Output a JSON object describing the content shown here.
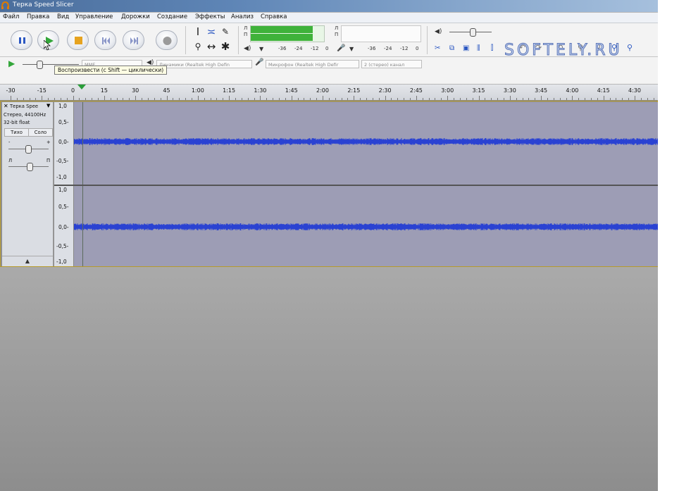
{
  "window": {
    "title": "Терка Speed Slicer"
  },
  "menu": [
    "Файл",
    "Правка",
    "Вид",
    "Управление",
    "Дорожки",
    "Создание",
    "Эффекты",
    "Анализ",
    "Справка"
  ],
  "tooltip": "Воспроизвести (с Shift — циклически)",
  "meters": {
    "play_letters": [
      "Л",
      "П"
    ],
    "record_letters": [
      "Л",
      "П"
    ],
    "scale": [
      "-36",
      "-24",
      "-12",
      "0"
    ],
    "scale_rec": [
      "-36",
      "-24",
      "-12",
      "0"
    ],
    "play_level": 0.85
  },
  "device": {
    "host": "MME",
    "output": "Динамики (Realtek High Defin",
    "input": "Микрофон (Realtek High Defir",
    "channels": "2 (стерео) канал"
  },
  "watermark": "SOFTELY.RU",
  "ruler": [
    "-30",
    "-15",
    "0",
    "15",
    "30",
    "45",
    "1:00",
    "1:15",
    "1:30",
    "1:45",
    "2:00",
    "2:15",
    "2:30",
    "2:45",
    "3:00",
    "3:15",
    "3:30",
    "3:45",
    "4:00",
    "4:15",
    "4:30"
  ],
  "track": {
    "name": "Терка Spee",
    "info1": "Стерео, 44100Hz",
    "info2": "32-bit float",
    "mute": "Тихо",
    "solo": "Соло",
    "gain_minus": "-",
    "gain_plus": "+",
    "pan_left": "Л",
    "pan_right": "П",
    "scale": [
      "1,0",
      "0,5-",
      "0,0-",
      "-0,5-",
      "-1,0"
    ]
  },
  "colors": {
    "waveform": "#2a42d2",
    "track_bg": "#9d9db5",
    "meter_green": "#3fb23a",
    "accent_title": "#4b6e9c"
  }
}
